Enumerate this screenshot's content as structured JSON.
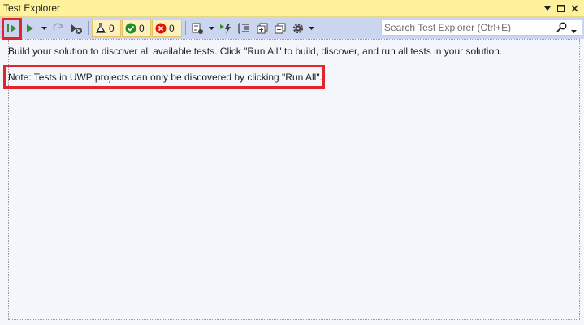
{
  "window": {
    "title": "Test Explorer"
  },
  "toolbar": {
    "passed_count": "0",
    "failed_count": "0",
    "not_run_count": "0",
    "icons": [
      "run-all-icon",
      "run-icon",
      "dropdown-icon",
      "repeat-icon",
      "cancel-icon",
      "flask-icon",
      "check-circle-icon",
      "x-circle-icon",
      "playlist-icon",
      "run-after-build-icon",
      "group-icon",
      "expand-icon",
      "collapse-icon",
      "gear-icon"
    ],
    "colors": {
      "run": "#388a34",
      "passed": "#1e8e1e",
      "failed": "#e51400",
      "highlight": "#e3242b"
    }
  },
  "search": {
    "placeholder": "Search Test Explorer (Ctrl+E)"
  },
  "content": {
    "info_message": "Build your solution to discover all available tests. Click \"Run All\" to build, discover, and run all tests in your solution.",
    "note_message": "Note: Tests in UWP projects can only be discovered by clicking \"Run All\"."
  }
}
